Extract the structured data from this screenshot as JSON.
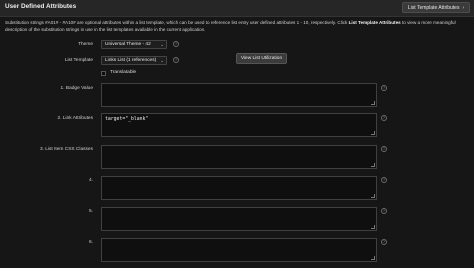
{
  "header": {
    "title": "User Defined Attributes",
    "button_label": "List Template Attributes",
    "button_icon": "chevron-right-icon"
  },
  "description": {
    "part1": "Substitution strings #A01# - #A10# are optional attributes within a list template, which can be used to reference list entry user defined attributes 1 - 10, respectively. Click ",
    "bold": "List Template Attributes",
    "part2": " to view a more meaningful description of the substitution strings in use in the list templates available in the current application."
  },
  "theme": {
    "label": "Theme",
    "value": "Universal Theme - 42"
  },
  "list_template": {
    "label": "List Template",
    "value": "Links List (1 references)"
  },
  "view_button": {
    "label": "View List Utilization"
  },
  "translatable": {
    "label": "Translatable",
    "checked": false
  },
  "attributes": [
    {
      "label": "1. Badge Value",
      "value": ""
    },
    {
      "label": "2. Link Attributes",
      "value": "target=\"_blank\""
    },
    {
      "label": "3. List Item CSS Classes",
      "value": ""
    },
    {
      "label": "4.",
      "value": ""
    },
    {
      "label": "5.",
      "value": ""
    },
    {
      "label": "6.",
      "value": ""
    }
  ],
  "help_glyph": "?",
  "caret_glyph": "⌄",
  "chevron_glyph": "›"
}
